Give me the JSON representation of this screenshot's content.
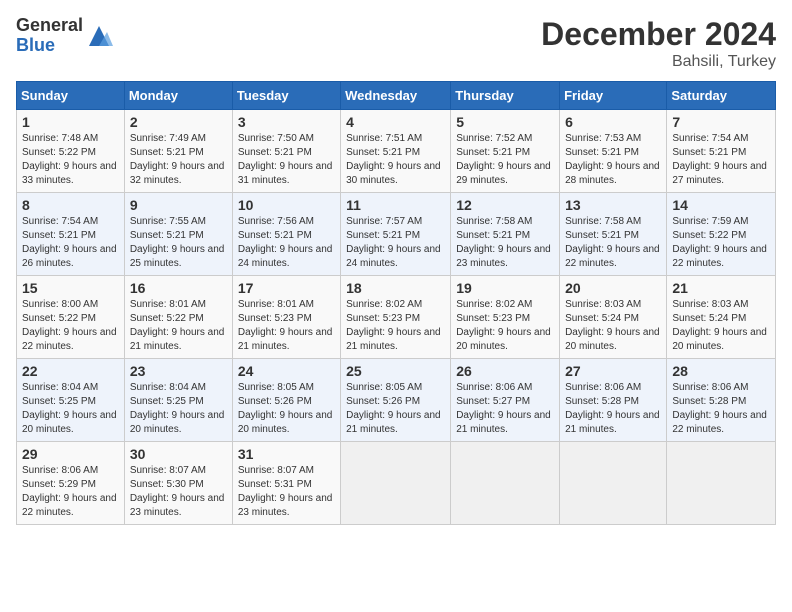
{
  "logo": {
    "general": "General",
    "blue": "Blue"
  },
  "title": {
    "month": "December 2024",
    "location": "Bahsili, Turkey"
  },
  "calendar": {
    "headers": [
      "Sunday",
      "Monday",
      "Tuesday",
      "Wednesday",
      "Thursday",
      "Friday",
      "Saturday"
    ],
    "weeks": [
      [
        {
          "day": "1",
          "sunrise": "7:48 AM",
          "sunset": "5:22 PM",
          "daylight": "9 hours and 33 minutes."
        },
        {
          "day": "2",
          "sunrise": "7:49 AM",
          "sunset": "5:21 PM",
          "daylight": "9 hours and 32 minutes."
        },
        {
          "day": "3",
          "sunrise": "7:50 AM",
          "sunset": "5:21 PM",
          "daylight": "9 hours and 31 minutes."
        },
        {
          "day": "4",
          "sunrise": "7:51 AM",
          "sunset": "5:21 PM",
          "daylight": "9 hours and 30 minutes."
        },
        {
          "day": "5",
          "sunrise": "7:52 AM",
          "sunset": "5:21 PM",
          "daylight": "9 hours and 29 minutes."
        },
        {
          "day": "6",
          "sunrise": "7:53 AM",
          "sunset": "5:21 PM",
          "daylight": "9 hours and 28 minutes."
        },
        {
          "day": "7",
          "sunrise": "7:54 AM",
          "sunset": "5:21 PM",
          "daylight": "9 hours and 27 minutes."
        }
      ],
      [
        {
          "day": "8",
          "sunrise": "7:54 AM",
          "sunset": "5:21 PM",
          "daylight": "9 hours and 26 minutes."
        },
        {
          "day": "9",
          "sunrise": "7:55 AM",
          "sunset": "5:21 PM",
          "daylight": "9 hours and 25 minutes."
        },
        {
          "day": "10",
          "sunrise": "7:56 AM",
          "sunset": "5:21 PM",
          "daylight": "9 hours and 24 minutes."
        },
        {
          "day": "11",
          "sunrise": "7:57 AM",
          "sunset": "5:21 PM",
          "daylight": "9 hours and 24 minutes."
        },
        {
          "day": "12",
          "sunrise": "7:58 AM",
          "sunset": "5:21 PM",
          "daylight": "9 hours and 23 minutes."
        },
        {
          "day": "13",
          "sunrise": "7:58 AM",
          "sunset": "5:21 PM",
          "daylight": "9 hours and 22 minutes."
        },
        {
          "day": "14",
          "sunrise": "7:59 AM",
          "sunset": "5:22 PM",
          "daylight": "9 hours and 22 minutes."
        }
      ],
      [
        {
          "day": "15",
          "sunrise": "8:00 AM",
          "sunset": "5:22 PM",
          "daylight": "9 hours and 22 minutes."
        },
        {
          "day": "16",
          "sunrise": "8:01 AM",
          "sunset": "5:22 PM",
          "daylight": "9 hours and 21 minutes."
        },
        {
          "day": "17",
          "sunrise": "8:01 AM",
          "sunset": "5:23 PM",
          "daylight": "9 hours and 21 minutes."
        },
        {
          "day": "18",
          "sunrise": "8:02 AM",
          "sunset": "5:23 PM",
          "daylight": "9 hours and 21 minutes."
        },
        {
          "day": "19",
          "sunrise": "8:02 AM",
          "sunset": "5:23 PM",
          "daylight": "9 hours and 20 minutes."
        },
        {
          "day": "20",
          "sunrise": "8:03 AM",
          "sunset": "5:24 PM",
          "daylight": "9 hours and 20 minutes."
        },
        {
          "day": "21",
          "sunrise": "8:03 AM",
          "sunset": "5:24 PM",
          "daylight": "9 hours and 20 minutes."
        }
      ],
      [
        {
          "day": "22",
          "sunrise": "8:04 AM",
          "sunset": "5:25 PM",
          "daylight": "9 hours and 20 minutes."
        },
        {
          "day": "23",
          "sunrise": "8:04 AM",
          "sunset": "5:25 PM",
          "daylight": "9 hours and 20 minutes."
        },
        {
          "day": "24",
          "sunrise": "8:05 AM",
          "sunset": "5:26 PM",
          "daylight": "9 hours and 20 minutes."
        },
        {
          "day": "25",
          "sunrise": "8:05 AM",
          "sunset": "5:26 PM",
          "daylight": "9 hours and 21 minutes."
        },
        {
          "day": "26",
          "sunrise": "8:06 AM",
          "sunset": "5:27 PM",
          "daylight": "9 hours and 21 minutes."
        },
        {
          "day": "27",
          "sunrise": "8:06 AM",
          "sunset": "5:28 PM",
          "daylight": "9 hours and 21 minutes."
        },
        {
          "day": "28",
          "sunrise": "8:06 AM",
          "sunset": "5:28 PM",
          "daylight": "9 hours and 22 minutes."
        }
      ],
      [
        {
          "day": "29",
          "sunrise": "8:06 AM",
          "sunset": "5:29 PM",
          "daylight": "9 hours and 22 minutes."
        },
        {
          "day": "30",
          "sunrise": "8:07 AM",
          "sunset": "5:30 PM",
          "daylight": "9 hours and 23 minutes."
        },
        {
          "day": "31",
          "sunrise": "8:07 AM",
          "sunset": "5:31 PM",
          "daylight": "9 hours and 23 minutes."
        },
        null,
        null,
        null,
        null
      ]
    ]
  }
}
